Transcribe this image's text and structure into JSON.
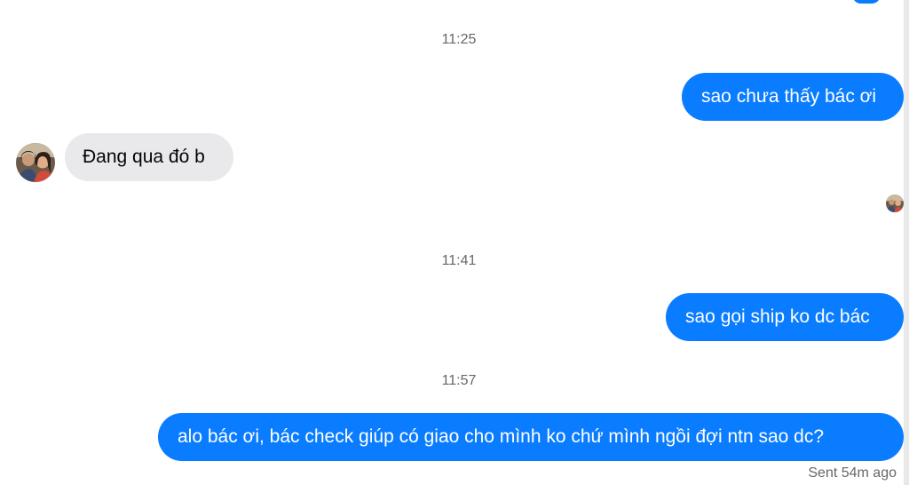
{
  "timestamps": [
    "11:25",
    "11:41",
    "11:57"
  ],
  "messages": [
    {
      "from": "me",
      "text": "sao chưa thấy bác ơi"
    },
    {
      "from": "them",
      "text": "Đang qua đó b"
    },
    {
      "from": "me",
      "text": "sao gọi ship ko dc bác"
    },
    {
      "from": "me",
      "text": "alo bác ơi, bác check giúp có giao cho mình ko chứ mình ngồi đợi ntn sao dc?"
    }
  ],
  "status": {
    "sent": "Sent 54m ago"
  },
  "icons": {
    "contact_avatar": "contact-avatar-icon",
    "read_receipt": "read-receipt-avatar-icon"
  },
  "colors": {
    "outgoing_bubble": "#0a7cff",
    "incoming_bubble": "#e9e9eb",
    "timestamp_text": "#65676b"
  }
}
